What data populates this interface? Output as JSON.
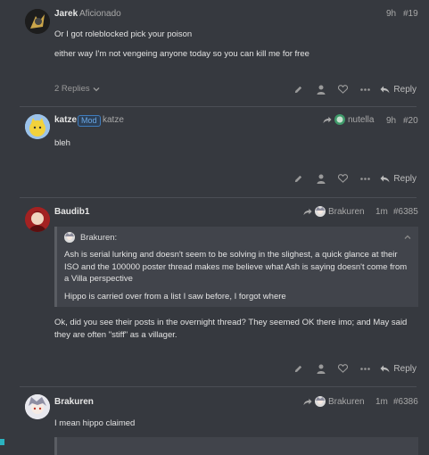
{
  "posts": [
    {
      "username": "Jarek",
      "user_title": "Aficionado",
      "time": "9h",
      "number": "#19",
      "paragraphs": [
        "Or I got roleblocked pick your poison",
        "either way I'm not vengeing anyone today so you can kill me for free"
      ],
      "replies_label": "2 Replies",
      "reply_label": "Reply"
    },
    {
      "username": "katze",
      "badge": "Mod",
      "user_title": "katze",
      "reply_to": "nutella",
      "time": "9h",
      "number": "#20",
      "paragraphs": [
        "bleh"
      ],
      "reply_label": "Reply"
    },
    {
      "username": "Baudib1",
      "reply_to": "Brakuren",
      "time": "1m",
      "number": "#6385",
      "quote": {
        "author": "Brakuren:",
        "paragraphs": [
          "Ash is serial lurking and doesn't seem to be solving in the slighest, a quick glance at their ISO and the 100000 poster thread makes me believe what Ash is saying doesn't come from a Villa perspective",
          "Hippo is carried over from a list I saw before, I forgot where"
        ]
      },
      "paragraphs": [
        "Ok, did you see their posts in the overnight thread? They seemed OK there imo; and May said they are often \"stiff\" as a villager."
      ],
      "reply_label": "Reply"
    },
    {
      "username": "Brakuren",
      "reply_to": "Brakuren",
      "time": "1m",
      "number": "#6386",
      "paragraphs": [
        "I mean hippo claimed"
      ]
    }
  ],
  "colors": {
    "background": "#36393f",
    "text": "#e2e2e2",
    "muted": "#a8a8a8",
    "mod_badge": "#6aa8e6"
  },
  "icons": [
    "pen-icon",
    "user-icon",
    "heart-icon",
    "more-icon",
    "reply-icon",
    "chevron-down-icon",
    "chevron-up-icon",
    "share-arrow-icon"
  ]
}
